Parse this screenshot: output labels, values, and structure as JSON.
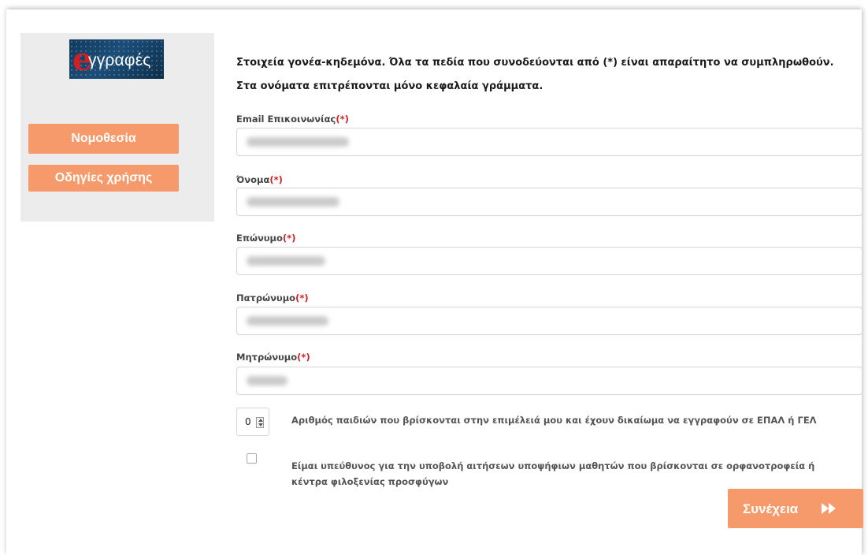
{
  "logo": {
    "letter": "e",
    "word": "γγραφές"
  },
  "sidebar": {
    "buttons": [
      {
        "label": "Νομοθεσία"
      },
      {
        "label": "Οδηγίες χρήσης"
      }
    ]
  },
  "form": {
    "intro_line1": "Στοιχεία γονέα-κηδεμόνα. Όλα τα πεδία που συνοδεύονται από (*) είναι απαραίτητο να συμπληρωθούν.",
    "intro_line2": "Στα ονόματα επιτρέπονται μόνο κεφαλαία γράμματα.",
    "required_marker": "(*)",
    "fields": [
      {
        "label": "Email Επικοινωνίας",
        "value_redacted": true
      },
      {
        "label": "Όνομα",
        "value_redacted": true
      },
      {
        "label": "Επώνυμο",
        "value_redacted": true
      },
      {
        "label": "Πατρώνυμο",
        "value_redacted": true
      },
      {
        "label": "Μητρώνυμο",
        "value_redacted": true
      }
    ],
    "children_count": {
      "value": "0",
      "label": "Αριθμός παιδιών που βρίσκονται στην επιμέλειά μου και έχουν δικαίωμα να εγγραφούν σε ΕΠΑΛ ή ΓΕΛ"
    },
    "orphanage_checkbox": {
      "checked": false,
      "label": "Είμαι υπεύθυνος για την υποβολή αιτήσεων υποψήφιων μαθητών που βρίσκονται σε ορφανοτροφεία ή κέντρα φιλοξενίας προσφύγων"
    },
    "continue_button": {
      "label": "Συνέχεια",
      "icon": "fast-forward-icon"
    }
  },
  "colors": {
    "accent": "#f79a6b",
    "required": "#d11f26",
    "sidebar_bg": "#ececec"
  }
}
